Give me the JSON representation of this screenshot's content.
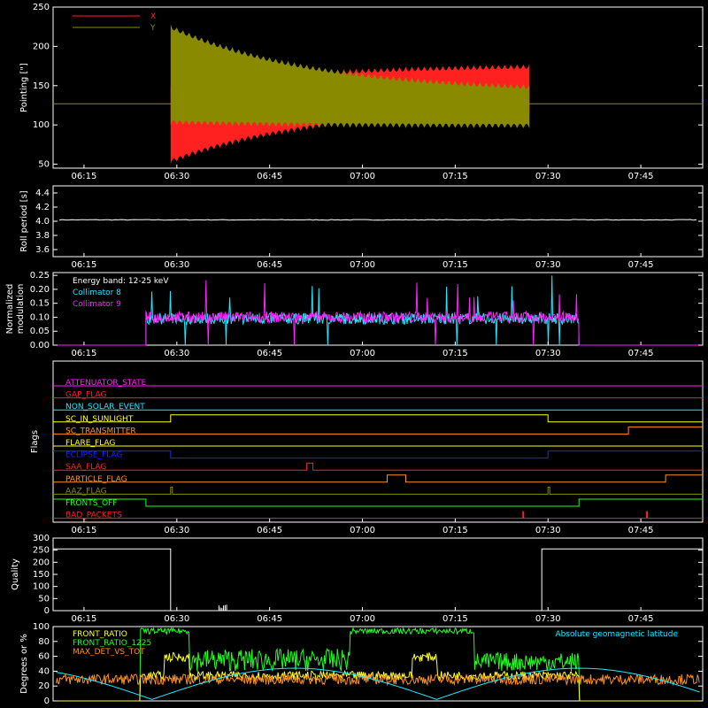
{
  "colors": {
    "background": "#000000",
    "axes": "#ffffff",
    "red": "#ff2020",
    "olive": "#8a8a00",
    "cyan": "#20e8ff",
    "magenta": "#ff20ff",
    "green": "#20ff20",
    "yellow": "#ffff20",
    "orange": "#ff9020",
    "blue": "#2020ff"
  },
  "chart_data": [
    {
      "type": "area",
      "ylabel": "Pointing [\"]",
      "ylim": [
        45,
        250
      ],
      "yticks": [
        50,
        100,
        150,
        200,
        250
      ],
      "xticks": [
        "06:15",
        "06:30",
        "06:45",
        "07:00",
        "07:15",
        "07:30",
        "07:45"
      ],
      "series": [
        {
          "name": "X",
          "color": "#ff2020",
          "start": "06:29",
          "end": "07:27",
          "envelope_low_start": 50,
          "envelope_low_end": 120,
          "envelope_high_start": 150,
          "envelope_high_end": 180,
          "oscillation_period_min": 1.0
        },
        {
          "name": "Y",
          "color": "#8a8a00",
          "start": "06:29",
          "end": "07:27",
          "envelope_low_start": 100,
          "envelope_low_end": 95,
          "envelope_high_start": 228,
          "envelope_high_end": 145,
          "oscillation_period_min": 1.0
        }
      ],
      "baseline": 127,
      "legend": "top-left"
    },
    {
      "type": "line",
      "ylabel": "Roll period [s]",
      "ylim": [
        3.5,
        4.5
      ],
      "yticks": [
        "3.6",
        "3.8",
        "4.0",
        "4.2",
        "4.4"
      ],
      "xticks": [
        "06:15",
        "06:30",
        "06:45",
        "07:00",
        "07:15",
        "07:30",
        "07:45"
      ],
      "series": [
        {
          "color": "#ffffff",
          "value": 4.02
        }
      ]
    },
    {
      "type": "line",
      "ylabel_lines": [
        "Normalized",
        "modulation"
      ],
      "ylim": [
        0,
        0.26
      ],
      "yticks": [
        "0.00",
        "0.05",
        "0.10",
        "0.15",
        "0.20",
        "0.25"
      ],
      "xticks": [
        "06:15",
        "06:30",
        "06:45",
        "07:00",
        "07:15",
        "07:30",
        "07:45"
      ],
      "annotation": "Energy band: 12-25 keV",
      "series": [
        {
          "name": "Collimator 8",
          "color": "#20e8ff",
          "start": "06:25",
          "end": "07:35",
          "level": 0.095
        },
        {
          "name": "Collimator 9",
          "color": "#ff20ff",
          "start": "06:25",
          "end": "07:35",
          "level": 0.1
        }
      ],
      "legend": "top-left"
    },
    {
      "type": "line",
      "ylabel": "Flags",
      "xticks": [
        "06:15",
        "06:30",
        "06:45",
        "07:00",
        "07:15",
        "07:30",
        "07:45"
      ],
      "flags": [
        {
          "name": "ATTENUATOR_STATE",
          "color": "#ff20ff",
          "high": []
        },
        {
          "name": "GAP_FLAG",
          "color": "#ff2020",
          "high": []
        },
        {
          "name": "NON_SOLAR_EVENT",
          "color": "#20e8ff",
          "high": []
        },
        {
          "name": "SC_IN_SUNLIGHT",
          "color": "#ffff20",
          "high": [
            [
              "06:29",
              "07:30"
            ]
          ]
        },
        {
          "name": "SC_TRANSMITTER",
          "color": "#ff9020",
          "high": [
            [
              "07:43",
              "07:55"
            ]
          ]
        },
        {
          "name": "FLARE_FLAG",
          "color": "#ffff20",
          "high": []
        },
        {
          "name": "ECLIPSE_FLAG",
          "color": "#2020ff",
          "high": [
            [
              "06:10",
              "06:29"
            ],
            [
              "07:30",
              "07:55"
            ]
          ]
        },
        {
          "name": "SAA_FLAG",
          "color": "#ff2020",
          "high": [
            [
              "06:51",
              "06:52"
            ]
          ]
        },
        {
          "name": "PARTICLE_FLAG",
          "color": "#ff9020",
          "high": [
            [
              "07:04",
              "07:07"
            ],
            [
              "07:49",
              "07:55"
            ]
          ]
        },
        {
          "name": "AAZ_FLAG",
          "color": "#8a8a00",
          "high": [
            [
              "06:29",
              "06:29"
            ],
            [
              "07:30",
              "07:30"
            ]
          ]
        },
        {
          "name": "FRONTS_OFF",
          "color": "#20ff20",
          "high": [
            [
              "06:10",
              "06:25"
            ],
            [
              "07:35",
              "07:55"
            ]
          ]
        },
        {
          "name": "BAD_PACKETS",
          "color": "#ff2020",
          "spikes": [
            "07:26",
            "07:46"
          ]
        }
      ]
    },
    {
      "type": "line",
      "ylabel": "Quality",
      "ylim": [
        0,
        300
      ],
      "yticks": [
        "0",
        "50",
        "100",
        "150",
        "200",
        "250",
        "300"
      ],
      "xticks": [
        "06:15",
        "06:30",
        "06:45",
        "07:00",
        "07:15",
        "07:30",
        "07:45"
      ],
      "series": [
        {
          "color": "#ffffff",
          "segments": [
            {
              "start": "06:10",
              "end": "06:29",
              "value": 255
            },
            {
              "start": "06:29",
              "end": "07:29",
              "value": 0
            },
            {
              "start": "07:29",
              "end": "07:55",
              "value": 255
            }
          ]
        }
      ]
    },
    {
      "type": "line",
      "ylabel": "Degrees or %",
      "ylim": [
        0,
        100
      ],
      "yticks": [
        "0",
        "20",
        "40",
        "60",
        "80",
        "100"
      ],
      "xticks": [
        "06:15",
        "06:30",
        "06:45",
        "07:00",
        "07:15",
        "07:30",
        "07:45"
      ],
      "series": [
        {
          "name": "FRONT_RATIO",
          "color": "#ffff20"
        },
        {
          "name": "FRONT_RATIO_1225",
          "color": "#20ff20"
        },
        {
          "name": "MAX_DET_VS_TOT",
          "color": "#ff9020"
        },
        {
          "name": "Absolute geomagnetic latitude",
          "color": "#20e8ff"
        }
      ],
      "legend": "top-left"
    }
  ]
}
